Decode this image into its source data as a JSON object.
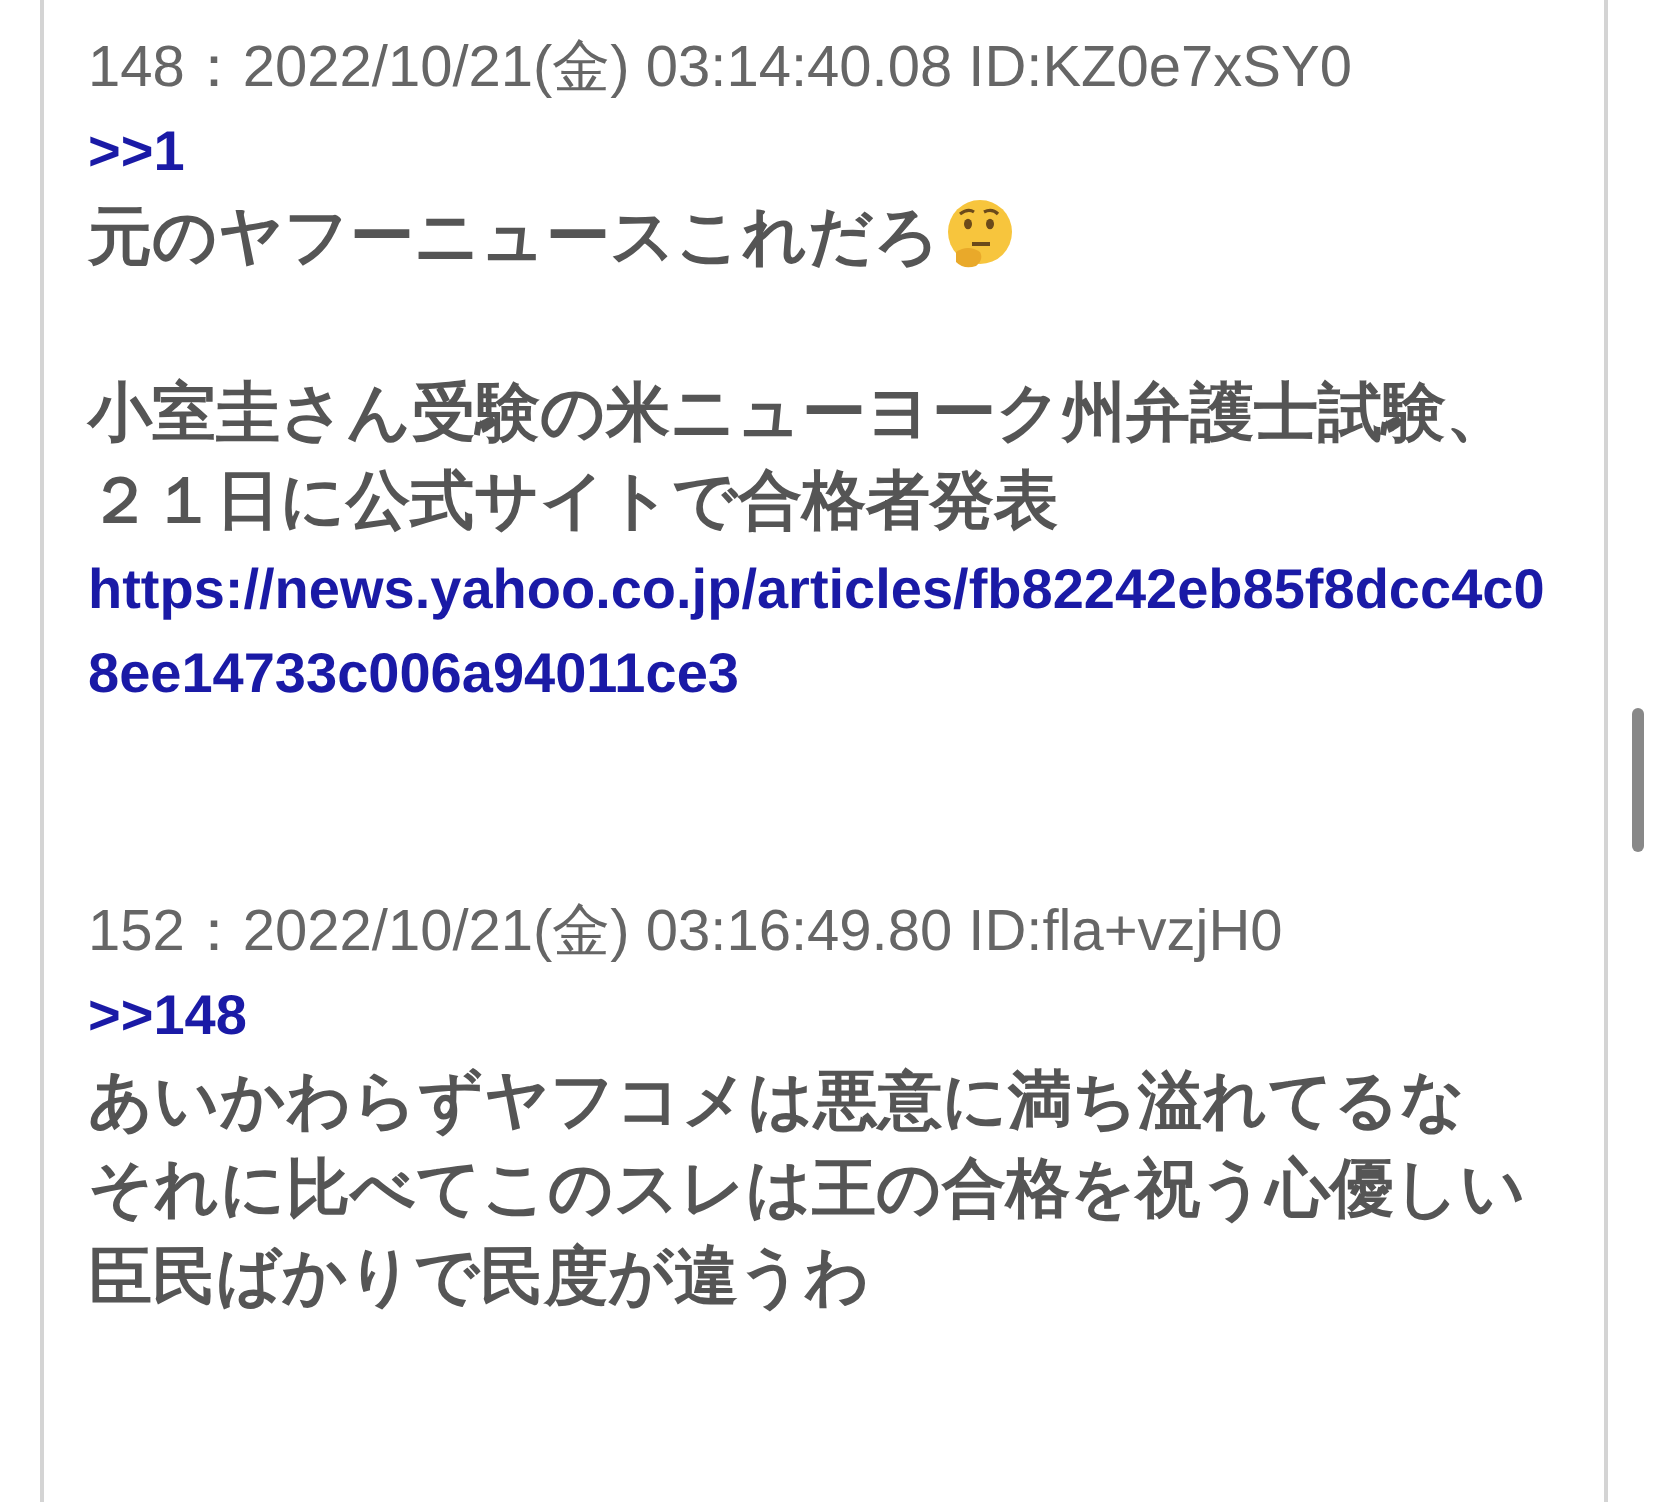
{
  "posts": [
    {
      "header": "148：2022/10/21(金) 03:14:40.08 ID:KZ0e7xSY0",
      "reply_link": ">>1",
      "body": [
        {
          "kind": "text",
          "text": "元のヤフーニュースこれだろ",
          "trailing_icon": true
        },
        {
          "kind": "blank"
        },
        {
          "kind": "text",
          "text": "小室圭さん受験の米ニューヨーク州弁護士試験、２１日に公式サイトで合格者発表",
          "trailing_icon": false
        },
        {
          "kind": "link",
          "text": "https://news.yahoo.co.jp/articles/fb82242eb85f8dcc4c08ee14733c006a94011ce3"
        }
      ]
    },
    {
      "header": "152：2022/10/21(金) 03:16:49.80 ID:fla+vzjH0",
      "reply_link": ">>148",
      "body": [
        {
          "kind": "text",
          "text": "あいかわらずヤフコメは悪意に満ち溢れてるな",
          "trailing_icon": false
        },
        {
          "kind": "text",
          "text": "それに比べてこのスレは王の合格を祝う心優しい臣民ばかりで民度が違うわ",
          "trailing_icon": false
        }
      ]
    }
  ]
}
